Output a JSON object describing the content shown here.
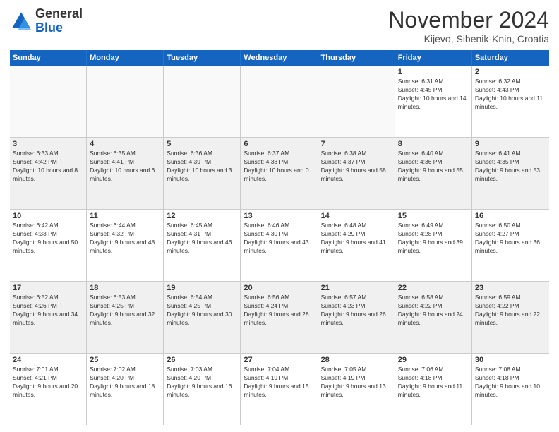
{
  "logo": {
    "general": "General",
    "blue": "Blue"
  },
  "title": "November 2024",
  "location": "Kijevo, Sibenik-Knin, Croatia",
  "days_of_week": [
    "Sunday",
    "Monday",
    "Tuesday",
    "Wednesday",
    "Thursday",
    "Friday",
    "Saturday"
  ],
  "rows": [
    [
      {
        "day": "",
        "info": "",
        "empty": true
      },
      {
        "day": "",
        "info": "",
        "empty": true
      },
      {
        "day": "",
        "info": "",
        "empty": true
      },
      {
        "day": "",
        "info": "",
        "empty": true
      },
      {
        "day": "",
        "info": "",
        "empty": true
      },
      {
        "day": "1",
        "info": "Sunrise: 6:31 AM\nSunset: 4:45 PM\nDaylight: 10 hours and 14 minutes."
      },
      {
        "day": "2",
        "info": "Sunrise: 6:32 AM\nSunset: 4:43 PM\nDaylight: 10 hours and 11 minutes."
      }
    ],
    [
      {
        "day": "3",
        "info": "Sunrise: 6:33 AM\nSunset: 4:42 PM\nDaylight: 10 hours and 8 minutes.",
        "shaded": true
      },
      {
        "day": "4",
        "info": "Sunrise: 6:35 AM\nSunset: 4:41 PM\nDaylight: 10 hours and 6 minutes.",
        "shaded": true
      },
      {
        "day": "5",
        "info": "Sunrise: 6:36 AM\nSunset: 4:39 PM\nDaylight: 10 hours and 3 minutes.",
        "shaded": true
      },
      {
        "day": "6",
        "info": "Sunrise: 6:37 AM\nSunset: 4:38 PM\nDaylight: 10 hours and 0 minutes.",
        "shaded": true
      },
      {
        "day": "7",
        "info": "Sunrise: 6:38 AM\nSunset: 4:37 PM\nDaylight: 9 hours and 58 minutes.",
        "shaded": true
      },
      {
        "day": "8",
        "info": "Sunrise: 6:40 AM\nSunset: 4:36 PM\nDaylight: 9 hours and 55 minutes.",
        "shaded": true
      },
      {
        "day": "9",
        "info": "Sunrise: 6:41 AM\nSunset: 4:35 PM\nDaylight: 9 hours and 53 minutes.",
        "shaded": true
      }
    ],
    [
      {
        "day": "10",
        "info": "Sunrise: 6:42 AM\nSunset: 4:33 PM\nDaylight: 9 hours and 50 minutes."
      },
      {
        "day": "11",
        "info": "Sunrise: 6:44 AM\nSunset: 4:32 PM\nDaylight: 9 hours and 48 minutes."
      },
      {
        "day": "12",
        "info": "Sunrise: 6:45 AM\nSunset: 4:31 PM\nDaylight: 9 hours and 46 minutes."
      },
      {
        "day": "13",
        "info": "Sunrise: 6:46 AM\nSunset: 4:30 PM\nDaylight: 9 hours and 43 minutes."
      },
      {
        "day": "14",
        "info": "Sunrise: 6:48 AM\nSunset: 4:29 PM\nDaylight: 9 hours and 41 minutes."
      },
      {
        "day": "15",
        "info": "Sunrise: 6:49 AM\nSunset: 4:28 PM\nDaylight: 9 hours and 39 minutes."
      },
      {
        "day": "16",
        "info": "Sunrise: 6:50 AM\nSunset: 4:27 PM\nDaylight: 9 hours and 36 minutes."
      }
    ],
    [
      {
        "day": "17",
        "info": "Sunrise: 6:52 AM\nSunset: 4:26 PM\nDaylight: 9 hours and 34 minutes.",
        "shaded": true
      },
      {
        "day": "18",
        "info": "Sunrise: 6:53 AM\nSunset: 4:25 PM\nDaylight: 9 hours and 32 minutes.",
        "shaded": true
      },
      {
        "day": "19",
        "info": "Sunrise: 6:54 AM\nSunset: 4:25 PM\nDaylight: 9 hours and 30 minutes.",
        "shaded": true
      },
      {
        "day": "20",
        "info": "Sunrise: 6:56 AM\nSunset: 4:24 PM\nDaylight: 9 hours and 28 minutes.",
        "shaded": true
      },
      {
        "day": "21",
        "info": "Sunrise: 6:57 AM\nSunset: 4:23 PM\nDaylight: 9 hours and 26 minutes.",
        "shaded": true
      },
      {
        "day": "22",
        "info": "Sunrise: 6:58 AM\nSunset: 4:22 PM\nDaylight: 9 hours and 24 minutes.",
        "shaded": true
      },
      {
        "day": "23",
        "info": "Sunrise: 6:59 AM\nSunset: 4:22 PM\nDaylight: 9 hours and 22 minutes.",
        "shaded": true
      }
    ],
    [
      {
        "day": "24",
        "info": "Sunrise: 7:01 AM\nSunset: 4:21 PM\nDaylight: 9 hours and 20 minutes."
      },
      {
        "day": "25",
        "info": "Sunrise: 7:02 AM\nSunset: 4:20 PM\nDaylight: 9 hours and 18 minutes."
      },
      {
        "day": "26",
        "info": "Sunrise: 7:03 AM\nSunset: 4:20 PM\nDaylight: 9 hours and 16 minutes."
      },
      {
        "day": "27",
        "info": "Sunrise: 7:04 AM\nSunset: 4:19 PM\nDaylight: 9 hours and 15 minutes."
      },
      {
        "day": "28",
        "info": "Sunrise: 7:05 AM\nSunset: 4:19 PM\nDaylight: 9 hours and 13 minutes."
      },
      {
        "day": "29",
        "info": "Sunrise: 7:06 AM\nSunset: 4:18 PM\nDaylight: 9 hours and 11 minutes."
      },
      {
        "day": "30",
        "info": "Sunrise: 7:08 AM\nSunset: 4:18 PM\nDaylight: 9 hours and 10 minutes."
      }
    ]
  ]
}
